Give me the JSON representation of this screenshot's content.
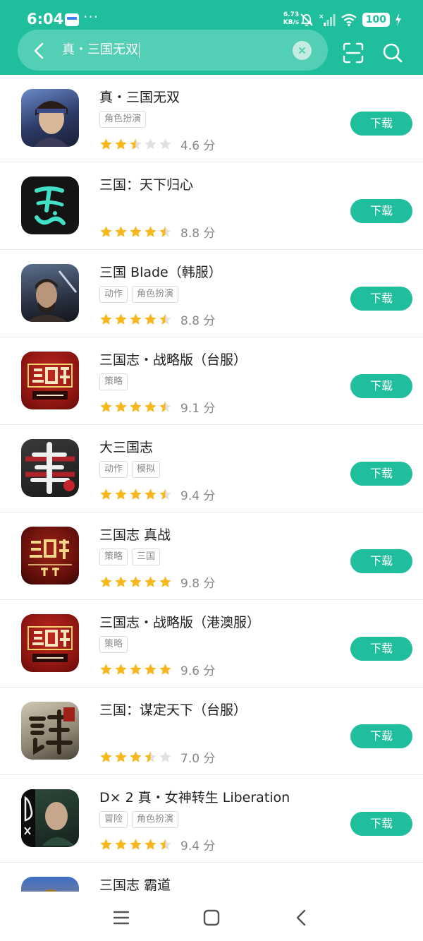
{
  "status": {
    "time": "6:04",
    "more": "···",
    "net_speed_value": "6.73",
    "net_speed_unit": "KB/s",
    "battery": "100"
  },
  "search": {
    "query": "真・三国无双"
  },
  "icons": {
    "back": "chevron-left-icon",
    "clear": "close-icon",
    "scan": "scan-icon",
    "search": "search-icon"
  },
  "colors": {
    "accent": "#1fbe9c",
    "star_filled": "#f8b81d",
    "star_empty": "#e2e2e2"
  },
  "apps": [
    {
      "name": "真・三国无双",
      "tags": [
        "角色扮演"
      ],
      "stars": 2.5,
      "score": "4.6 分",
      "action": "下载"
    },
    {
      "name": "三国：天下归心",
      "tags": [],
      "stars": 4.5,
      "score": "8.8 分",
      "action": "下载"
    },
    {
      "name": "三国 Blade（韩服）",
      "tags": [
        "动作",
        "角色扮演"
      ],
      "stars": 4.5,
      "score": "8.8 分",
      "action": "下载"
    },
    {
      "name": "三国志・战略版（台服）",
      "tags": [
        "策略"
      ],
      "stars": 4.5,
      "score": "9.1 分",
      "action": "下载"
    },
    {
      "name": "大三国志",
      "tags": [
        "动作",
        "模拟"
      ],
      "stars": 4.5,
      "score": "9.4 分",
      "action": "下载"
    },
    {
      "name": "三国志 真战",
      "tags": [
        "策略",
        "三国"
      ],
      "stars": 5,
      "score": "9.8 分",
      "action": "下载"
    },
    {
      "name": "三国志・战略版（港澳服）",
      "tags": [
        "策略"
      ],
      "stars": 5,
      "score": "9.6 分",
      "action": "下载"
    },
    {
      "name": "三国：谋定天下（台服）",
      "tags": [],
      "stars": 3.5,
      "score": "7.0 分",
      "action": "下载"
    },
    {
      "name": "D× 2 真・女神转生 Liberation",
      "tags": [
        "冒险",
        "角色扮演"
      ],
      "stars": 4.5,
      "score": "9.4 分",
      "action": "下载"
    },
    {
      "name": "三国志 霸道",
      "tags": [],
      "stars": 0,
      "score": "",
      "action": ""
    }
  ],
  "nav": {
    "menu": "menu-icon",
    "home": "home-icon",
    "back": "back-icon"
  }
}
